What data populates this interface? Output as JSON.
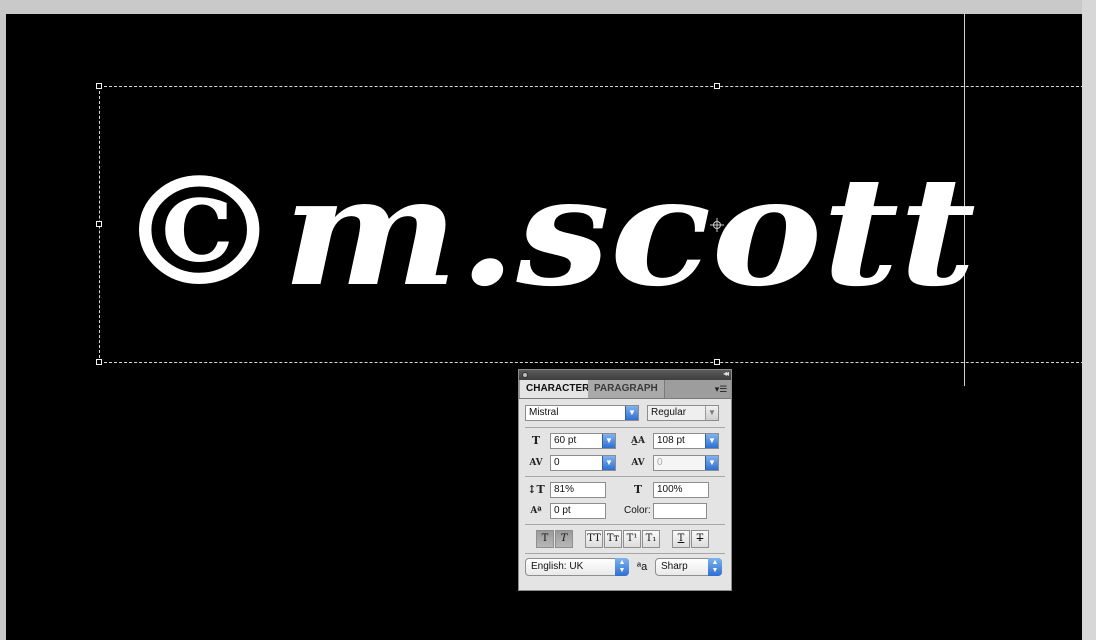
{
  "canvas": {
    "artwork_text": "©m.scott"
  },
  "panel": {
    "tabs": [
      {
        "label": "CHARACTER",
        "active": true
      },
      {
        "label": "PARAGRAPH",
        "active": false
      }
    ],
    "font_family": "Mistral",
    "font_style": "Regular",
    "font_size": "60 pt",
    "leading": "108 pt",
    "kerning": "0",
    "tracking": "0",
    "vertical_scale": "81%",
    "horizontal_scale": "100%",
    "baseline_shift": "0 pt",
    "color_label": "Color:",
    "color_value": "#ffffff",
    "style_buttons": [
      {
        "label": "T",
        "name": "faux-bold"
      },
      {
        "label": "T",
        "name": "faux-italic"
      },
      {
        "label": "TT",
        "name": "all-caps"
      },
      {
        "label": "Tт",
        "name": "small-caps"
      },
      {
        "label": "T¹",
        "name": "superscript"
      },
      {
        "label": "T₁",
        "name": "subscript"
      },
      {
        "label": "T",
        "name": "underline"
      },
      {
        "label": "T",
        "name": "strikethrough"
      }
    ],
    "language": "English: UK",
    "antialias_icon_text": "ªa",
    "antialias": "Sharp"
  }
}
